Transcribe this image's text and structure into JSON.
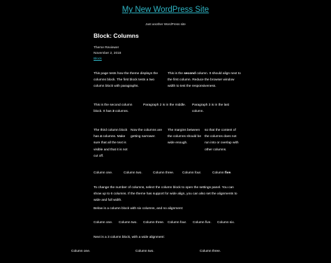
{
  "site": {
    "title": "My New WordPress Site",
    "tagline": "Just another WordPress site"
  },
  "post": {
    "title": "Block: Columns",
    "author": "Theme Reviewer",
    "date": "November 2, 2018",
    "category": "Block"
  },
  "two_col": {
    "col1": "This page tests how the theme displays the columns block. The first block tests a two column block with paragraphs.",
    "col2_a": "This is the ",
    "col2_b": "second",
    "col2_c": " column. It should align next to the first column. Reduce the browser window width to test the responsiveness."
  },
  "three_col": {
    "col1_a": "This is the second column block. It has ",
    "col1_b": "3",
    "col1_c": " columns.",
    "col2": "Paragraph 2 is in the middle.",
    "col3": "Paragraph 3 is in the last column."
  },
  "four_col": {
    "col1_a": "The third column block has ",
    "col1_b": "4",
    "col1_c": " columns. Make sure that all the text is visible and that it is not cut off.",
    "col2": "Now the columns are getting narrower.",
    "col3": "The margins between the columns should be wide enough.",
    "col4": "so that the content of the columns does not run into or overlap with other columns."
  },
  "five_col": {
    "c1": "Column one.",
    "c2": "Column two.",
    "c3": "Column three.",
    "c4": "Column four.",
    "c5_a": "Column ",
    "c5_b": "five",
    "c5_c": "."
  },
  "paragraphs": {
    "p1": "To change the number of columns, select the column block to open the settings panel. You can show up to 6 columns. If the theme has support for wide align, you can also set the alignments to wide and full width.",
    "p2": "Below is a column block with six columns, and no alignment:",
    "p3": "Next is a 3 column block, with a wide alignment:"
  },
  "six_col": {
    "c1": "Column one.",
    "c2": "Column two.",
    "c3": "Column three.",
    "c4": "Column four.",
    "c5": "Column five.",
    "c6": "Column six."
  },
  "wide_col": {
    "c1": "Column one.",
    "c2": "Column two.",
    "c3": "Column three."
  }
}
